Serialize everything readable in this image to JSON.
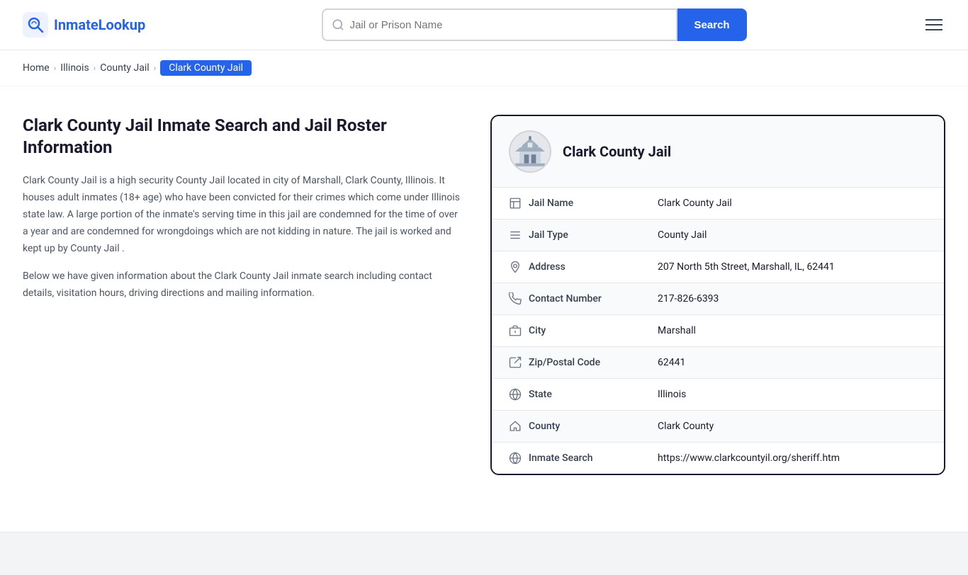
{
  "header": {
    "logo_name": "InmateLookup",
    "logo_name_part1": "Inmate",
    "logo_name_part2": "Lookup",
    "search_placeholder": "Jail or Prison Name",
    "search_button_label": "Search"
  },
  "breadcrumb": {
    "items": [
      {
        "label": "Home",
        "href": "#"
      },
      {
        "label": "Illinois",
        "href": "#"
      },
      {
        "label": "County Jail",
        "href": "#"
      },
      {
        "label": "Clark County Jail",
        "active": true
      }
    ]
  },
  "left": {
    "title": "Clark County Jail Inmate Search and Jail Roster Information",
    "description1": "Clark County Jail is a high security County Jail located in city of Marshall, Clark County, Illinois. It houses adult inmates (18+ age) who have been convicted for their crimes which come under Illinois state law. A large portion of the inmate's serving time in this jail are condemned for the time of over a year and are condemned for wrongdoings which are not kidding in nature. The jail is worked and kept up by County Jail .",
    "description2": "Below we have given information about the Clark County Jail inmate search including contact details, visitation hours, driving directions and mailing information."
  },
  "card": {
    "jail_name_header": "Clark County Jail",
    "rows": [
      {
        "icon": "jail-icon",
        "label": "Jail Name",
        "value": "Clark County Jail",
        "link": false
      },
      {
        "icon": "type-icon",
        "label": "Jail Type",
        "value": "County Jail",
        "link": true,
        "href": "#"
      },
      {
        "icon": "location-icon",
        "label": "Address",
        "value": "207 North 5th Street, Marshall, IL, 62441",
        "link": false
      },
      {
        "icon": "phone-icon",
        "label": "Contact Number",
        "value": "217-826-6393",
        "link": true,
        "href": "tel:217-826-6393"
      },
      {
        "icon": "city-icon",
        "label": "City",
        "value": "Marshall",
        "link": false
      },
      {
        "icon": "zip-icon",
        "label": "Zip/Postal Code",
        "value": "62441",
        "link": false
      },
      {
        "icon": "state-icon",
        "label": "State",
        "value": "Illinois",
        "link": true,
        "href": "#"
      },
      {
        "icon": "county-icon",
        "label": "County",
        "value": "Clark County",
        "link": false
      },
      {
        "icon": "web-icon",
        "label": "Inmate Search",
        "value": "https://www.clarkcountyil.org/sheriff.htm",
        "link": true,
        "href": "https://www.clarkcountyil.org/sheriff.htm"
      }
    ]
  },
  "icons": {
    "jail-icon": "🏛",
    "type-icon": "≡",
    "location-icon": "📍",
    "phone-icon": "📞",
    "city-icon": "🏙",
    "zip-icon": "✉",
    "state-icon": "🌐",
    "county-icon": "🗺",
    "web-icon": "🌐"
  }
}
